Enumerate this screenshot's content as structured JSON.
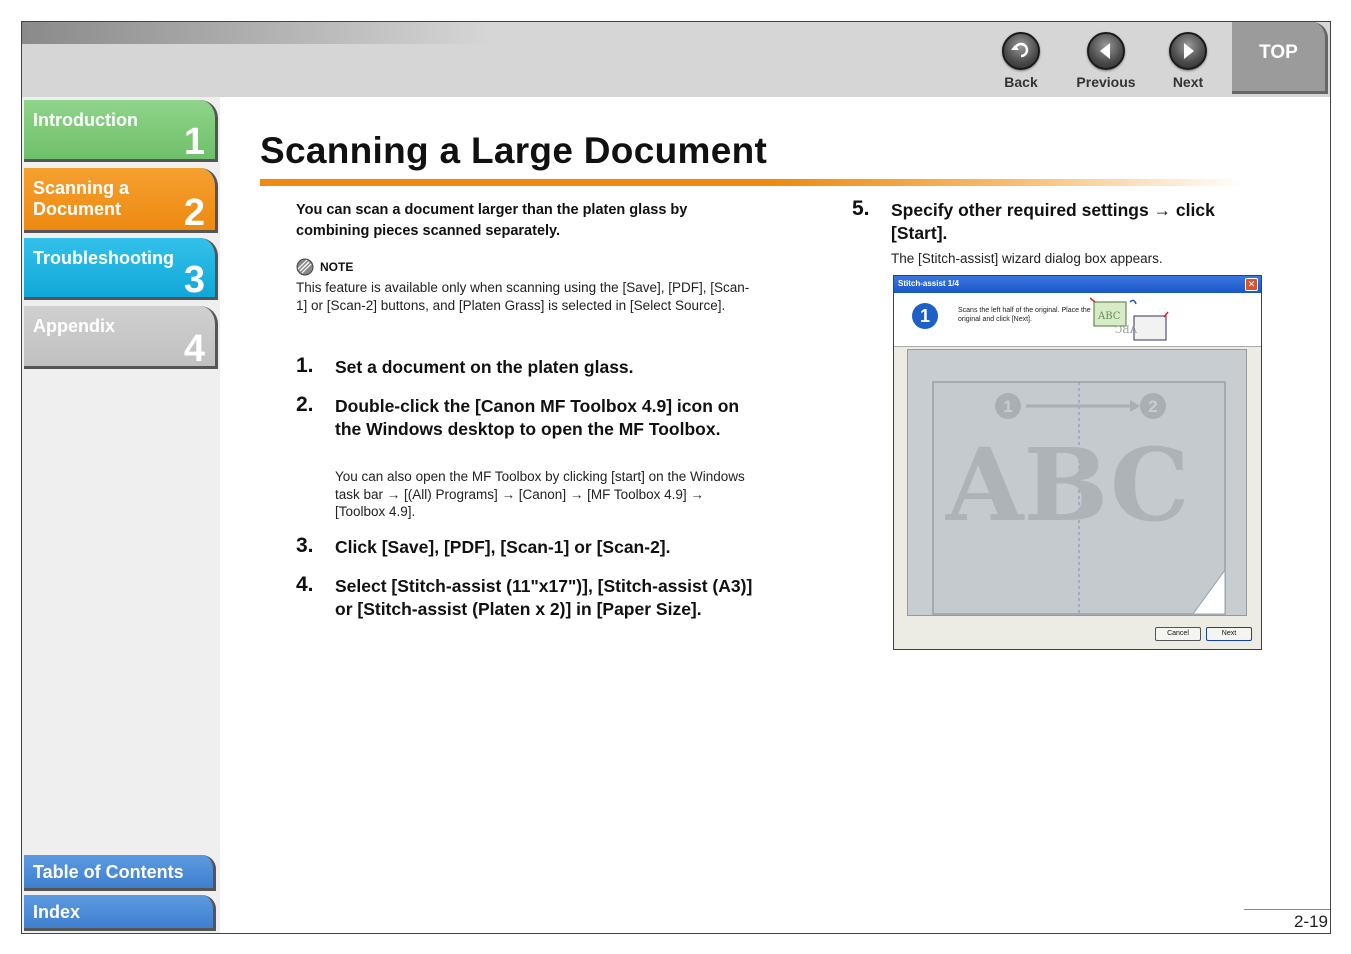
{
  "header": {
    "back_label": "Back",
    "previous_label": "Previous",
    "next_label": "Next",
    "top_label": "TOP"
  },
  "sidebar": {
    "tabs": [
      {
        "label": "Introduction",
        "number": "1"
      },
      {
        "label": "Scanning a Document",
        "number": "2"
      },
      {
        "label": "Troubleshooting",
        "number": "3"
      },
      {
        "label": "Appendix",
        "number": "4"
      }
    ],
    "toc_label": "Table of Contents",
    "index_label": "Index"
  },
  "page": {
    "title": "Scanning a Large Document",
    "intro": "You can scan a document larger than the platen glass by combining pieces scanned separately.",
    "note_heading": "NOTE",
    "note_text": "This feature is available only when scanning using the [Save], [PDF], [Scan-1] or [Scan-2] buttons, and [Platen Grass] is selected in [Select Source].",
    "steps": [
      {
        "num": "1.",
        "text": "Set a document on the platen glass.",
        "sub": ""
      },
      {
        "num": "2.",
        "text": "Double-click the [Canon MF Toolbox 4.9] icon on the Windows desktop to open the MF Toolbox.",
        "sub": "You can also open the MF Toolbox by clicking [start] on the Windows task bar → [(All) Programs] → [Canon] → [MF Toolbox 4.9] → [Toolbox 4.9]."
      },
      {
        "num": "3.",
        "text": "Click [Save], [PDF], [Scan-1] or [Scan-2].",
        "sub": ""
      },
      {
        "num": "4.",
        "text": "Select [Stitch-assist (11\"x17\")], [Stitch-assist (A3)] or [Stitch-assist (Platen x 2)] in [Paper Size].",
        "sub": ""
      },
      {
        "num": "5.",
        "text": "Specify other required settings → click [Start].",
        "sub": "The [Stitch-assist] wizard dialog box appears."
      }
    ],
    "page_number": "2-19"
  },
  "dialog": {
    "title": "Stitch-assist 1/4",
    "step_badge": "1",
    "instruction": "Scans the left half of the original. Place the original and click [Next].",
    "preview_text": "ABC",
    "mark_1": "1",
    "mark_2": "2",
    "cancel_label": "Cancel",
    "next_label": "Next"
  },
  "colors": {
    "orange": "#ee8a10",
    "green": "#6fc06a",
    "cyan": "#10a8d8",
    "gray": "#c0c0c0",
    "blue": "#3f7fcf"
  }
}
